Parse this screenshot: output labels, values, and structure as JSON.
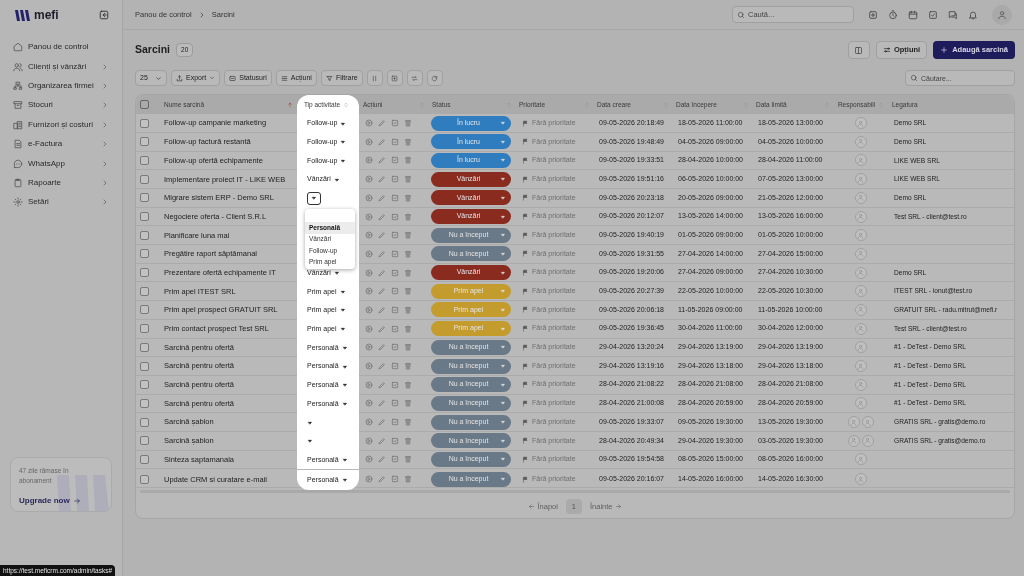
{
  "sidebar": {
    "logo_text": "mefi",
    "items": [
      {
        "label": "Panou de control",
        "submenu": false
      },
      {
        "label": "Clienți și vânzări",
        "submenu": true
      },
      {
        "label": "Organizarea firmei",
        "submenu": true
      },
      {
        "label": "Stocuri",
        "submenu": true
      },
      {
        "label": "Furnizori și costuri",
        "submenu": true
      },
      {
        "label": "e-Factura",
        "submenu": true
      },
      {
        "label": "WhatsApp",
        "submenu": true
      },
      {
        "label": "Rapoarte",
        "submenu": true
      },
      {
        "label": "Setări",
        "submenu": true
      }
    ],
    "upgrade": {
      "text": "47 zile rămase în abonament",
      "link": "Upgrade now"
    }
  },
  "topbar": {
    "breadcrumb": [
      "Panou de control",
      "Sarcini"
    ],
    "search": {
      "placeholder": "Caută..."
    }
  },
  "page": {
    "title": "Sarcini",
    "count": "20",
    "buttons": {
      "options": "Opțiuni",
      "add": "Adaugă sarcină"
    }
  },
  "toolbar": {
    "page_size": "25",
    "buttons": [
      "Export",
      "Statusuri",
      "Acțiuni",
      "Filtrare"
    ],
    "search": {
      "placeholder": "Căutare..."
    }
  },
  "table": {
    "select_all_checked": false,
    "columns": [
      "Nume sarcină",
      "Tip activitate",
      "Acțiuni",
      "Status",
      "Prioritate",
      "Data creare",
      "Data începere",
      "Data limită",
      "Responsabili",
      "Legatura"
    ],
    "rows": [
      {
        "checked": false,
        "name": "Follow-up campanie marketing",
        "activity_open": false,
        "activity_type": "Follow-up",
        "status": {
          "label": "În lucru",
          "color": "#2f7dbf"
        },
        "priority": "Fără prioritate",
        "created": "09-05-2026 20:18:49",
        "start": "18-05-2026 11:00:00",
        "due": "18-05-2026 13:00:00",
        "two_assignees": false,
        "link": "Demo SRL"
      },
      {
        "checked": false,
        "name": "Follow-up factură restantă",
        "activity_open": false,
        "activity_type": "Follow-up",
        "status": {
          "label": "În lucru",
          "color": "#2f7dbf"
        },
        "priority": "Fără prioritate",
        "created": "09-05-2026 19:48:49",
        "start": "04-05-2026 09:00:00",
        "due": "04-05-2026 10:00:00",
        "two_assignees": false,
        "link": "Demo SRL"
      },
      {
        "checked": false,
        "name": "Follow-up ofertă echipamente",
        "activity_open": false,
        "activity_type": "Follow-up",
        "status": {
          "label": "În lucru",
          "color": "#2f7dbf"
        },
        "priority": "Fără prioritate",
        "created": "09-05-2026 19:33:51",
        "start": "28-04-2026 10:00:00",
        "due": "28-04-2026 11:00:00",
        "two_assignees": false,
        "link": "LIKE WEB SRL"
      },
      {
        "checked": false,
        "name": "Implementare proiect IT - LIKE WEB",
        "activity_open": false,
        "activity_type": "Vânzări",
        "status": {
          "label": "Vânzări",
          "color": "#8a2b20"
        },
        "priority": "Fără prioritate",
        "created": "09-05-2026 19:51:16",
        "start": "06-05-2026 10:00:00",
        "due": "07-05-2026 13:00:00",
        "two_assignees": false,
        "link": "LIKE WEB SRL"
      },
      {
        "checked": false,
        "name": "Migrare sistem ERP - Demo SRL",
        "activity_open": true,
        "status": {
          "label": "Vânzări",
          "color": "#8a2b20"
        },
        "priority": "Fără prioritate",
        "created": "09-05-2026 20:23:18",
        "start": "20-05-2026 09:00:00",
        "due": "21-05-2026 12:00:00",
        "two_assignees": false,
        "link": "Demo SRL"
      },
      {
        "checked": false,
        "name": "Negociere oferta - Client S.R.L",
        "status": {
          "label": "Vânzări",
          "color": "#8a2b20"
        },
        "priority": "Fără prioritate",
        "created": "09-05-2026 20:12:07",
        "start": "13-05-2026 14:00:00",
        "due": "13-05-2026 16:00:00",
        "two_assignees": false,
        "link": "Test SRL - client@test.ro"
      },
      {
        "checked": false,
        "name": "Planificare luna mai",
        "status": {
          "label": "Nu a început",
          "color": "#6a7987"
        },
        "priority": "Fără prioritate",
        "created": "09-05-2026 19:40:19",
        "start": "01-05-2026 09:00:00",
        "due": "01-05-2026 10:00:00",
        "two_assignees": false
      },
      {
        "checked": false,
        "name": "Pregătire raport săptămanal",
        "status": {
          "label": "Nu a început",
          "color": "#6a7987"
        },
        "priority": "Fără prioritate",
        "created": "09-05-2026 19:31:55",
        "start": "27-04-2026 14:00:00",
        "due": "27-04-2026 15:00:00",
        "two_assignees": false
      },
      {
        "checked": false,
        "name": "Prezentare ofertă echipamente IT",
        "activity_open": false,
        "activity_type": "Vânzări",
        "status": {
          "label": "Vânzări",
          "color": "#8a2b20"
        },
        "priority": "Fără prioritate",
        "created": "09-05-2026 19:20:06",
        "start": "27-04-2026 09:00:00",
        "due": "27-04-2026 10:30:00",
        "two_assignees": false,
        "link": "Demo SRL"
      },
      {
        "checked": false,
        "name": "Prim apel ITEST SRL",
        "activity_open": false,
        "activity_type": "Prim apel",
        "status": {
          "label": "Prim apel",
          "color": "#c49c2e"
        },
        "priority": "Fără prioritate",
        "created": "09-05-2026 20:27:39",
        "start": "22-05-2026 10:00:00",
        "due": "22-05-2026 10:30:00",
        "two_assignees": false,
        "link": "ITEST SRL - ionut@test.ro"
      },
      {
        "checked": false,
        "name": "Prim apel prospect GRATUIT SRL",
        "activity_open": false,
        "activity_type": "Prim apel",
        "status": {
          "label": "Prim apel",
          "color": "#c49c2e"
        },
        "priority": "Fără prioritate",
        "created": "09-05-2026 20:06:18",
        "start": "11-05-2026 09:00:00",
        "due": "11-05-2026 10:00:00",
        "two_assignees": false,
        "link": "GRATUIT SRL - radu.mitrut@mefi.r"
      },
      {
        "checked": false,
        "name": "Prim contact prospect Test SRL",
        "activity_open": false,
        "activity_type": "Prim apel",
        "status": {
          "label": "Prim apel",
          "color": "#c49c2e"
        },
        "priority": "Fără prioritate",
        "created": "09-05-2026 19:36:45",
        "start": "30-04-2026 11:00:00",
        "due": "30-04-2026 12:00:00",
        "two_assignees": false,
        "link": "Test SRL - client@test.ro"
      },
      {
        "checked": false,
        "name": "Sarcină pentru ofertă",
        "activity_open": false,
        "activity_type": "Personală",
        "status": {
          "label": "Nu a început",
          "color": "#6a7987"
        },
        "priority": "Fără prioritate",
        "created": "29-04-2026 13:20:24",
        "start": "29-04-2026 13:19:00",
        "due": "29-04-2026 13:19:00",
        "two_assignees": false,
        "link": "#1 - DeTest - Demo SRL"
      },
      {
        "checked": false,
        "name": "Sarcină pentru ofertă",
        "activity_open": false,
        "activity_type": "Personală",
        "status": {
          "label": "Nu a început",
          "color": "#6a7987"
        },
        "priority": "Fără prioritate",
        "created": "29-04-2026 13:19:16",
        "start": "29-04-2026 13:18:00",
        "due": "29-04-2026 13:18:00",
        "two_assignees": false,
        "link": "#1 - DeTest - Demo SRL"
      },
      {
        "checked": false,
        "name": "Sarcină pentru ofertă",
        "activity_open": false,
        "activity_type": "Personală",
        "status": {
          "label": "Nu a început",
          "color": "#6a7987"
        },
        "priority": "Fără prioritate",
        "created": "28-04-2026 21:08:22",
        "start": "28-04-2026 21:08:00",
        "due": "28-04-2026 21:08:00",
        "two_assignees": false,
        "link": "#1 - DeTest - Demo SRL"
      },
      {
        "checked": false,
        "name": "Sarcină pentru ofertă",
        "activity_open": false,
        "activity_type": "Personală",
        "status": {
          "label": "Nu a început",
          "color": "#6a7987"
        },
        "priority": "Fără prioritate",
        "created": "28-04-2026 21:00:08",
        "start": "28-04-2026 20:59:00",
        "due": "28-04-2026 20:59:00",
        "two_assignees": false,
        "link": "#1 - DeTest - Demo SRL"
      },
      {
        "checked": false,
        "name": "Sarcină șablon",
        "activity_open": false,
        "status": {
          "label": "Nu a început",
          "color": "#6a7987"
        },
        "priority": "Fără prioritate",
        "created": "09-05-2026 19:33:07",
        "start": "09-05-2026 19:30:00",
        "due": "13-05-2026 19:30:00",
        "two_assignees": true,
        "link": "GRATIS SRL - gratis@demo.ro"
      },
      {
        "checked": false,
        "name": "Sarcină șablon",
        "activity_open": false,
        "status": {
          "label": "Nu a început",
          "color": "#6a7987"
        },
        "priority": "Fără prioritate",
        "created": "28-04-2026 20:49:34",
        "start": "29-04-2026 19:30:00",
        "due": "03-05-2026 19:30:00",
        "two_assignees": true,
        "link": "GRATIS SRL - gratis@demo.ro"
      },
      {
        "checked": false,
        "name": "Sinteza saptamanala",
        "activity_open": false,
        "activity_type": "Personală",
        "status": {
          "label": "Nu a început",
          "color": "#6a7987"
        },
        "priority": "Fără prioritate",
        "created": "09-05-2026 19:54:58",
        "start": "08-05-2026 15:00:00",
        "due": "08-05-2026 16:00:00",
        "two_assignees": false
      },
      {
        "checked": false,
        "name": "Update CRM si curatare e-mail",
        "activity_open": false,
        "activity_type": "Personală",
        "status": {
          "label": "Nu a început",
          "color": "#6a7987"
        },
        "priority": "Fără prioritate",
        "created": "09-05-2026 20:16:07",
        "start": "14-05-2026 16:00:00",
        "due": "14-05-2026 16:30:00",
        "two_assignees": false
      }
    ]
  },
  "activity_menu": {
    "options": [
      {
        "label": "Personală",
        "highlighted": true
      },
      {
        "label": "Vânzări",
        "highlighted": false
      },
      {
        "label": "Follow-up",
        "highlighted": false
      },
      {
        "label": "Prim apel",
        "highlighted": false
      }
    ]
  },
  "pagination": {
    "prev": "Înapoi",
    "page": "1",
    "next": "Înainte"
  },
  "status_bar": {
    "url": "https://test.meficrm.com/admin/tasks#"
  }
}
